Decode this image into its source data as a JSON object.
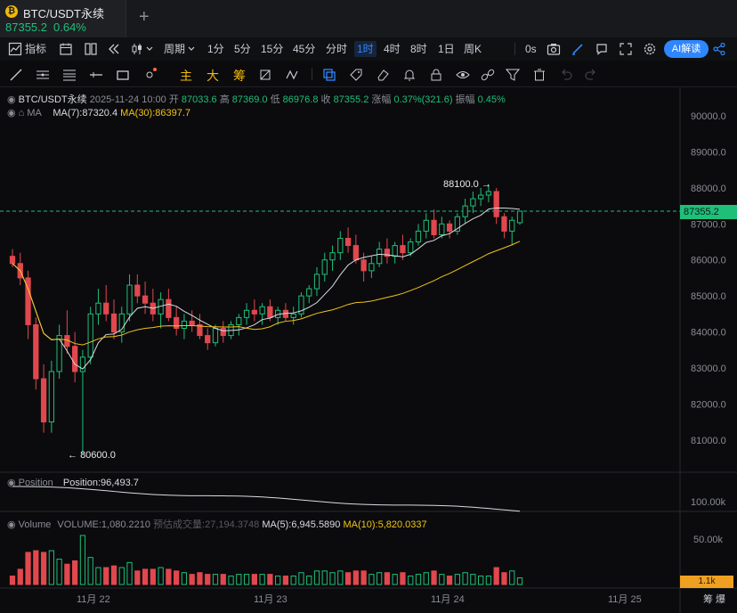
{
  "tab": {
    "title": "BTC/USDT永续",
    "price": "87355.2",
    "change": "0.64%",
    "add_label": "+"
  },
  "toolbar": {
    "indicators_label": "指标",
    "period_label": "周期",
    "intervals": [
      "1分",
      "5分",
      "15分",
      "45分",
      "分时",
      "1时",
      "4时",
      "8时",
      "1日",
      "周K"
    ],
    "active_interval": "1时",
    "seconds_label": "0s",
    "ai_label": "AI解读"
  },
  "drawbar": {
    "main_label": "主",
    "big_label": "大",
    "chip_label": "筹"
  },
  "legend": {
    "symbol": "BTC/USDT永续",
    "datetime": "2025-11-24 10:00",
    "open_label": "开",
    "open": "87033.6",
    "high_label": "高",
    "high": "87369.0",
    "low_label": "低",
    "low": "86976.8",
    "close_label": "收",
    "close": "87355.2",
    "change_label": "涨幅",
    "change": "0.37%(321.6)",
    "amplitude_label": "振幅",
    "amplitude": "0.45%",
    "ma_name": "MA",
    "ma7": "MA(7):87320.4",
    "ma30": "MA(30):86397.7"
  },
  "position_pane": {
    "name": "Position",
    "value": "Position:96,493.7",
    "axis_label": "100.00k"
  },
  "volume_pane": {
    "name": "Volume",
    "volume": "VOLUME:1,080.2210",
    "estimated": "预估成交量:27,194.3748",
    "ma5": "MA(5):6,945.5890",
    "ma10": "MA(10):5,820.0337",
    "axis_label": "50.00k",
    "current_tag": "1.1k"
  },
  "annotations": {
    "high": "88100.0",
    "low": "80600.0"
  },
  "current_price_tag": "87355.2",
  "x_dates": [
    "11月 22",
    "11月 23",
    "11月 24",
    "11月 25"
  ],
  "corner_label": "筹 爆",
  "colors": {
    "up": "#1fbf7a",
    "down": "#e0484e",
    "ma7": "#d9dbe0",
    "ma30": "#f0c419",
    "accent": "#2f86ff"
  },
  "chart_data": {
    "type": "candlestick",
    "y_ticks": [
      90000,
      89000,
      88000,
      87000,
      86000,
      85000,
      84000,
      83000,
      82000,
      81000
    ],
    "ylim": [
      80400,
      90300
    ],
    "candles_approx": [
      [
        86100,
        86300,
        85800,
        85900
      ],
      [
        85900,
        86200,
        85300,
        85500
      ],
      [
        85500,
        85700,
        83800,
        84200
      ],
      [
        84200,
        84400,
        82400,
        82700
      ],
      [
        82700,
        83100,
        81200,
        81500
      ],
      [
        81500,
        83200,
        81200,
        82900
      ],
      [
        82900,
        84200,
        82700,
        83900
      ],
      [
        83900,
        84600,
        83400,
        83600
      ],
      [
        83600,
        84000,
        82600,
        82900
      ],
      [
        82900,
        83500,
        80600,
        83300
      ],
      [
        83300,
        84700,
        83100,
        84500
      ],
      [
        84500,
        85200,
        84200,
        84800
      ],
      [
        84800,
        85300,
        84300,
        84500
      ],
      [
        84500,
        84900,
        83800,
        84000
      ],
      [
        84000,
        84700,
        83700,
        84500
      ],
      [
        84500,
        85600,
        84300,
        85300
      ],
      [
        85300,
        85600,
        84800,
        85000
      ],
      [
        85000,
        85400,
        84500,
        84800
      ],
      [
        84800,
        85200,
        84300,
        84500
      ],
      [
        84500,
        85100,
        84100,
        84900
      ],
      [
        84900,
        85200,
        84300,
        84400
      ],
      [
        84400,
        84700,
        83900,
        84100
      ],
      [
        84100,
        84500,
        83800,
        84300
      ],
      [
        84300,
        84600,
        84000,
        84200
      ],
      [
        84200,
        84500,
        83800,
        83900
      ],
      [
        83900,
        84100,
        83500,
        83700
      ],
      [
        83700,
        84200,
        83600,
        84100
      ],
      [
        84100,
        84300,
        83700,
        83900
      ],
      [
        83900,
        84300,
        83800,
        84200
      ],
      [
        84200,
        84500,
        83900,
        84400
      ],
      [
        84400,
        84800,
        84200,
        84600
      ],
      [
        84600,
        84900,
        84300,
        84500
      ],
      [
        84500,
        84800,
        84200,
        84700
      ],
      [
        84700,
        84900,
        84300,
        84400
      ],
      [
        84400,
        84700,
        84200,
        84600
      ],
      [
        84600,
        84800,
        84300,
        84400
      ],
      [
        84400,
        84700,
        84200,
        84500
      ],
      [
        84500,
        85100,
        84400,
        85000
      ],
      [
        85000,
        85300,
        84800,
        85200
      ],
      [
        85200,
        85800,
        85000,
        85600
      ],
      [
        85600,
        86200,
        85400,
        86000
      ],
      [
        86000,
        86400,
        85700,
        86200
      ],
      [
        86200,
        86800,
        86000,
        86600
      ],
      [
        86600,
        86900,
        86200,
        86400
      ],
      [
        86400,
        86700,
        85900,
        86000
      ],
      [
        86000,
        86200,
        85400,
        85700
      ],
      [
        85700,
        86100,
        85500,
        85900
      ],
      [
        85900,
        86500,
        85800,
        86300
      ],
      [
        86300,
        86600,
        85900,
        86100
      ],
      [
        86100,
        86500,
        85900,
        86400
      ],
      [
        86400,
        86700,
        86000,
        86200
      ],
      [
        86200,
        86600,
        86100,
        86500
      ],
      [
        86500,
        87000,
        86400,
        86800
      ],
      [
        86800,
        87300,
        86600,
        87100
      ],
      [
        87100,
        87400,
        86600,
        86700
      ],
      [
        86700,
        87200,
        86600,
        87000
      ],
      [
        87000,
        87100,
        86600,
        86800
      ],
      [
        86800,
        87300,
        86700,
        87200
      ],
      [
        87200,
        87700,
        87000,
        87500
      ],
      [
        87500,
        87900,
        87300,
        87700
      ],
      [
        87700,
        88000,
        87500,
        87800
      ],
      [
        87800,
        88100,
        87600,
        87900
      ],
      [
        87900,
        88000,
        87000,
        87200
      ],
      [
        87200,
        87300,
        86600,
        86800
      ],
      [
        86800,
        87200,
        86400,
        87100
      ],
      [
        87033.6,
        87369.0,
        86976.8,
        87355.2
      ]
    ]
  }
}
